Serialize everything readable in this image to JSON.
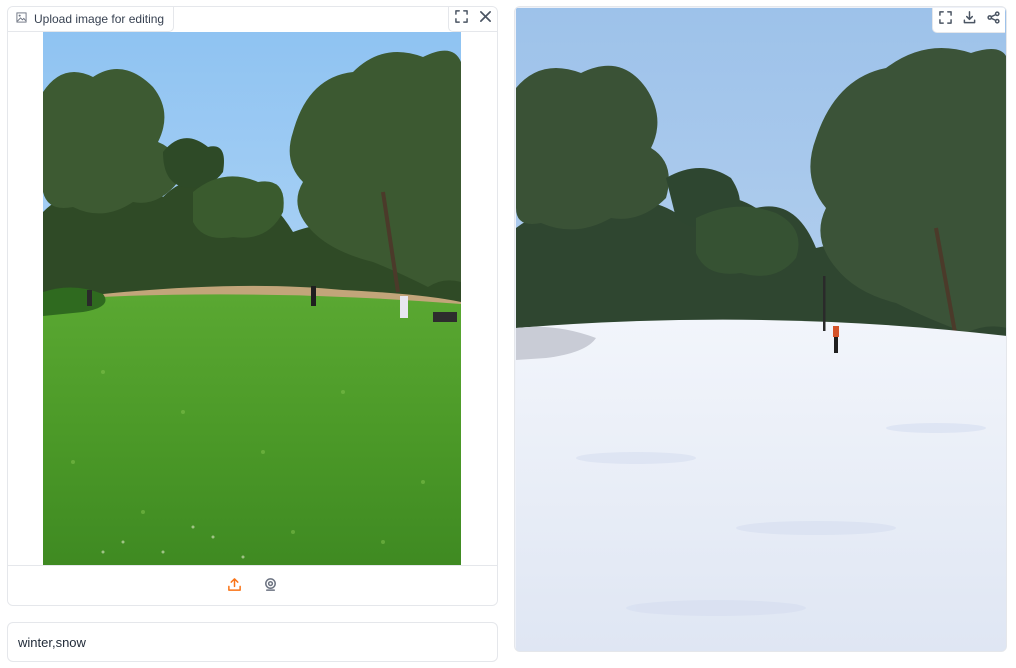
{
  "input_panel": {
    "label": "Upload image for editing",
    "icons": {
      "label": "image-icon",
      "fullscreen": "fullscreen-icon",
      "clear": "close-icon"
    },
    "source_buttons": [
      "upload-icon",
      "webcam-icon"
    ]
  },
  "prompt": {
    "value": "winter,snow"
  },
  "output_panel": {
    "icons": [
      "fullscreen-icon",
      "download-icon",
      "share-icon"
    ]
  },
  "colors": {
    "accent": "#f97316",
    "border": "#e5e7eb",
    "sky": "#9cc6ee",
    "grass": "#4a9a2a",
    "snow": "#e8ecf7"
  }
}
